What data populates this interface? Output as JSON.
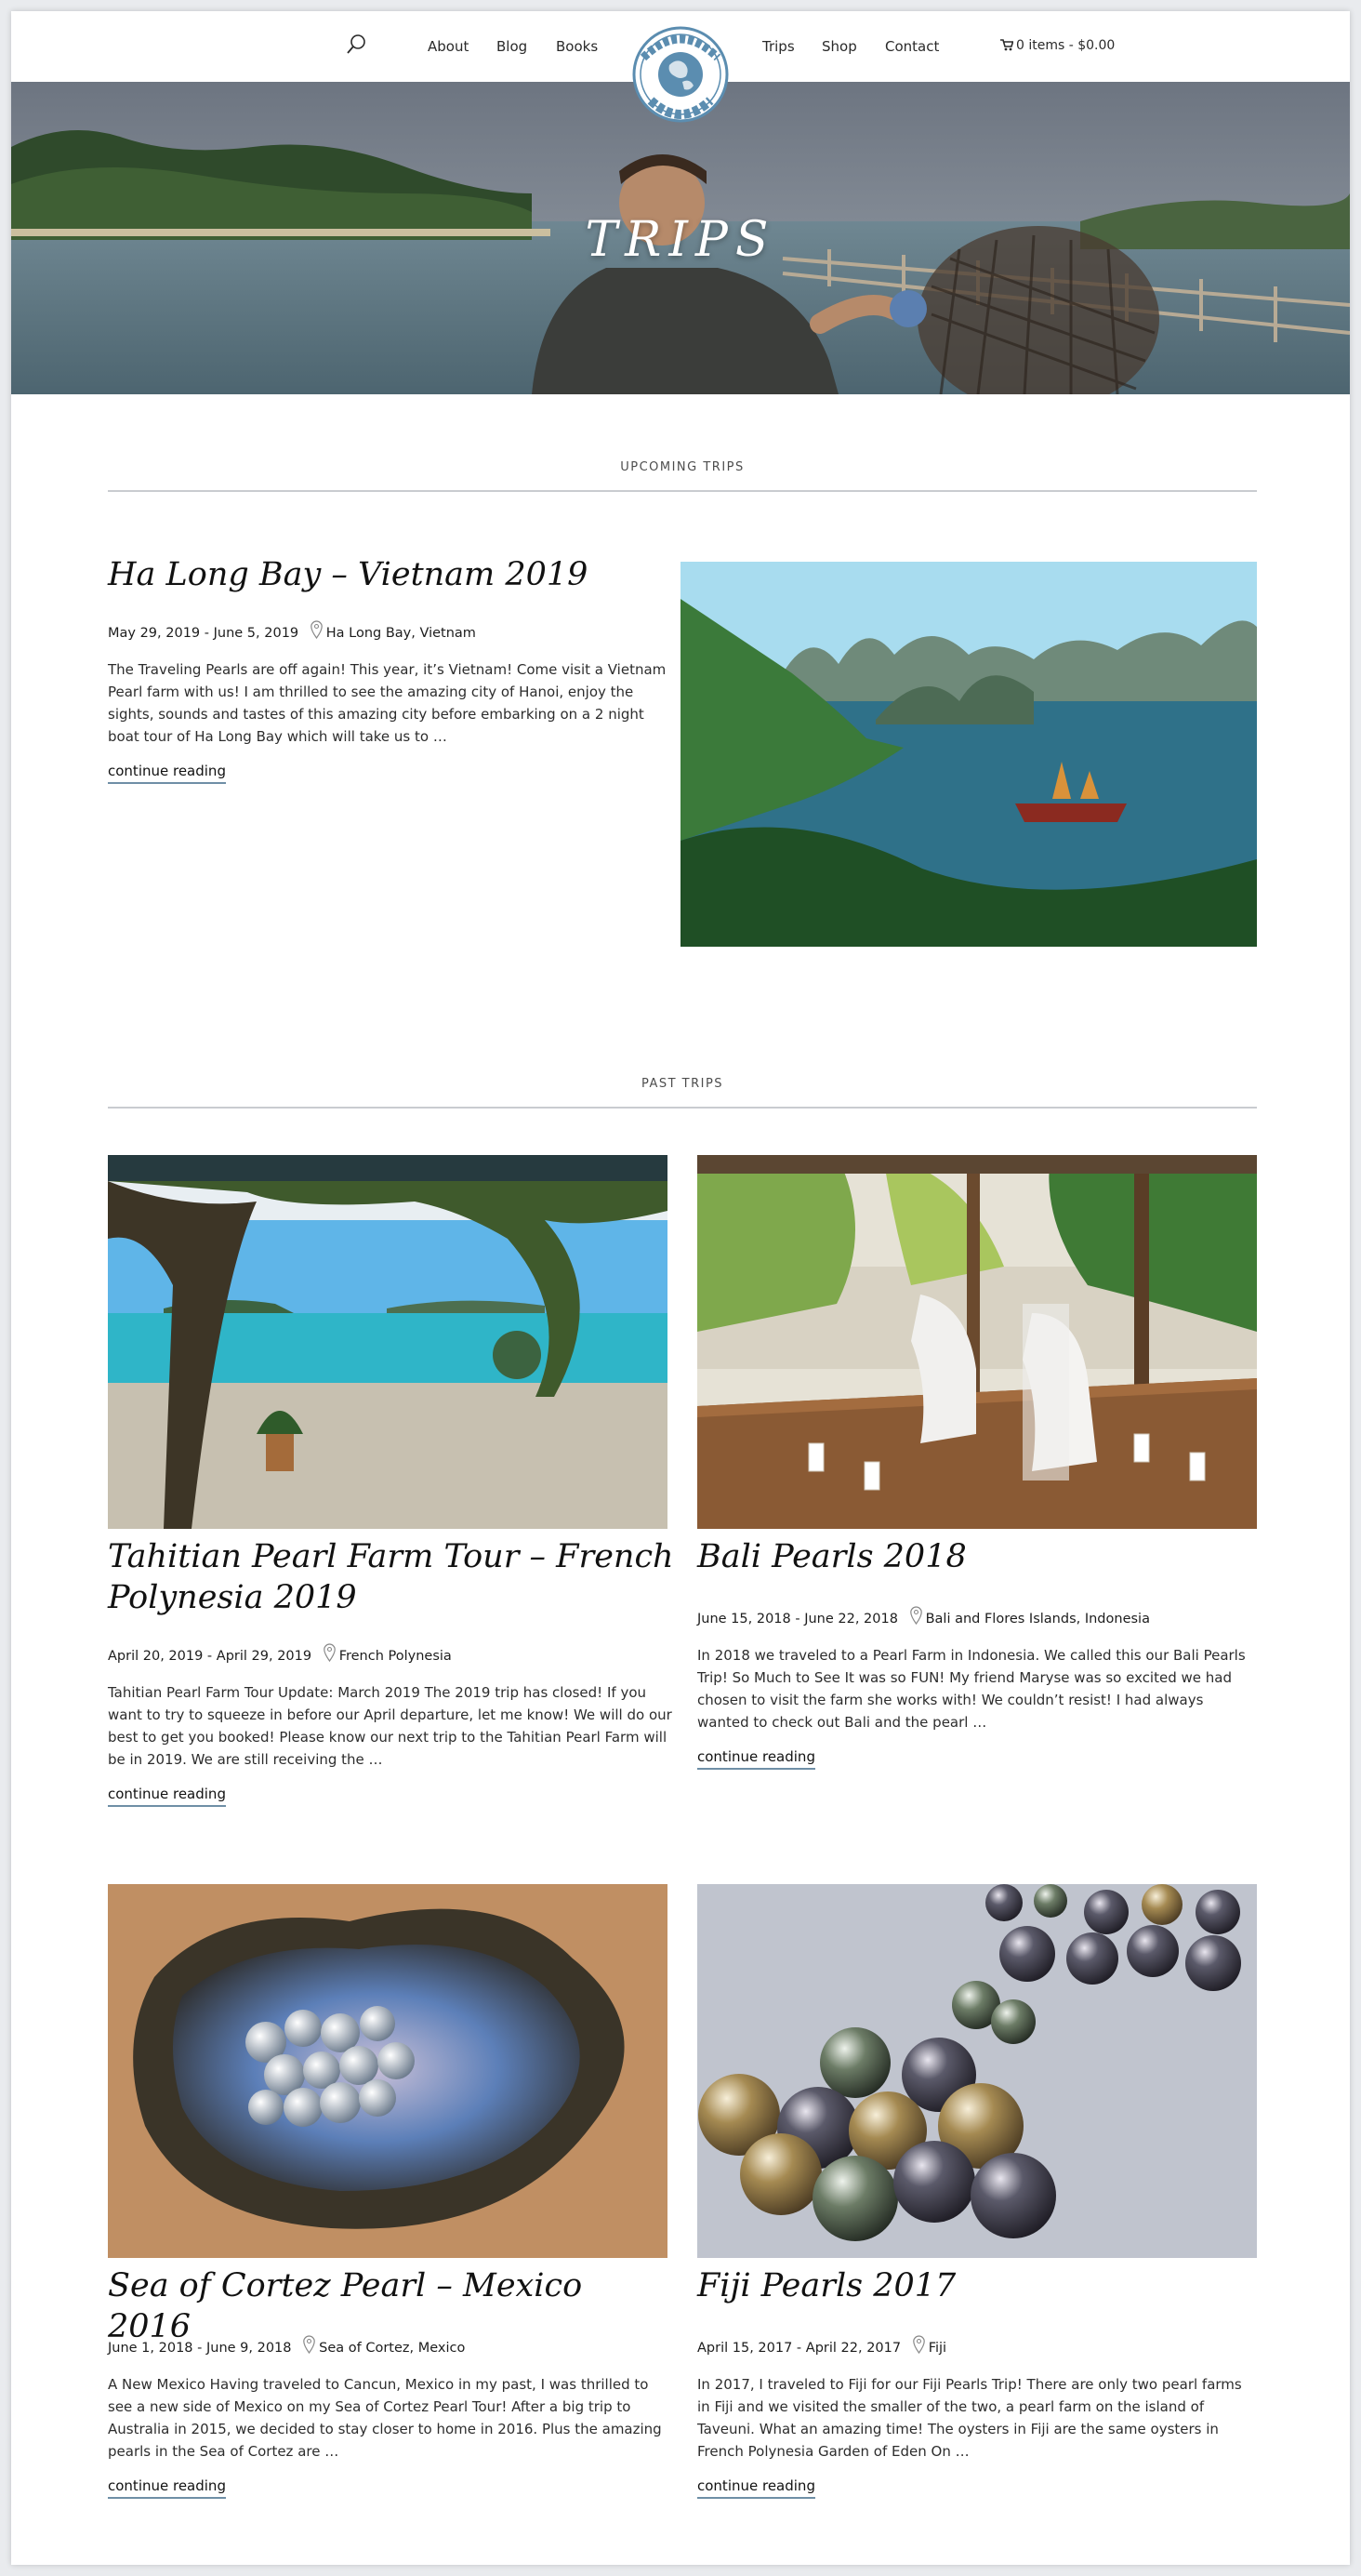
{
  "header": {
    "nav_left": [
      "About",
      "Blog",
      "Books"
    ],
    "nav_right": [
      "Trips",
      "Shop",
      "Contact"
    ],
    "cart_label": "0 items - $0.00",
    "logo_text": "THE WORLD OF PEARL"
  },
  "hero": {
    "title": "TRIPS"
  },
  "upcoming": {
    "heading": "UPCOMING TRIPS",
    "post": {
      "title": "Ha Long Bay – Vietnam 2019",
      "dates": "May 29, 2019 - June 5, 2019",
      "location": "Ha Long Bay, Vietnam",
      "excerpt": "The Traveling Pearls are off again! This year, it’s Vietnam! Come visit a Vietnam Pearl farm with us! I am thrilled to see the amazing city of Hanoi, enjoy the sights, sounds and tastes of this amazing city before embarking on a 2 night boat tour of Ha Long Bay which will take us to …",
      "read_more": "continue reading"
    }
  },
  "past": {
    "heading": "PAST TRIPS",
    "posts": [
      {
        "title": "Tahitian Pearl Farm Tour – French Polynesia 2019",
        "dates": "April 20, 2019 - April 29, 2019",
        "location": "French Polynesia",
        "excerpt": "Tahitian Pearl Farm Tour Update:  March 2019 The 2019 trip has closed! If you want to try to squeeze in before our April departure, let me know! We will do our best to get you booked! Please know our next trip to the Tahitian Pearl Farm will be in 2019. We are still receiving the …",
        "read_more": "continue reading"
      },
      {
        "title": "Bali Pearls 2018",
        "dates": "June 15, 2018 - June 22, 2018",
        "location": "Bali and Flores Islands, Indonesia",
        "excerpt": "In 2018 we traveled to a Pearl Farm in Indonesia. We called this our Bali Pearls Trip! So Much to See It was so FUN! My friend Maryse was so excited we had chosen to visit the farm she works with! We couldn’t resist! I had always wanted to check out Bali and the pearl …",
        "read_more": "continue reading"
      },
      {
        "title": "Sea of Cortez Pearl – Mexico 2016",
        "dates": "June 1, 2018 - June 9, 2018",
        "location": "Sea of Cortez, Mexico",
        "excerpt": "A New Mexico Having traveled to Cancun, Mexico in my past, I was thrilled to see a new side of Mexico on my Sea of Cortez Pearl Tour! After a big trip to Australia in 2015, we decided to stay closer to home in 2016. Plus the amazing pearls in the Sea of Cortez are …",
        "read_more": "continue reading"
      },
      {
        "title": "Fiji Pearls 2017",
        "dates": "April 15, 2017 - April 22, 2017",
        "location": "Fiji",
        "excerpt": "In 2017, I traveled to Fiji for our Fiji Pearls Trip! There are only two pearl farms in Fiji and we visited the smaller of the two, a pearl farm on the island of Taveuni. What an amazing time! The oysters in Fiji are the same oysters in French Polynesia   Garden of Eden On …",
        "read_more": "continue reading"
      }
    ]
  },
  "colors": {
    "accent_underline": "#6f8fa6",
    "rule": "#c9ccd0",
    "logo_blue": "#5b8db0"
  },
  "icons": [
    "search-icon",
    "cart-icon",
    "location-pin-icon"
  ]
}
